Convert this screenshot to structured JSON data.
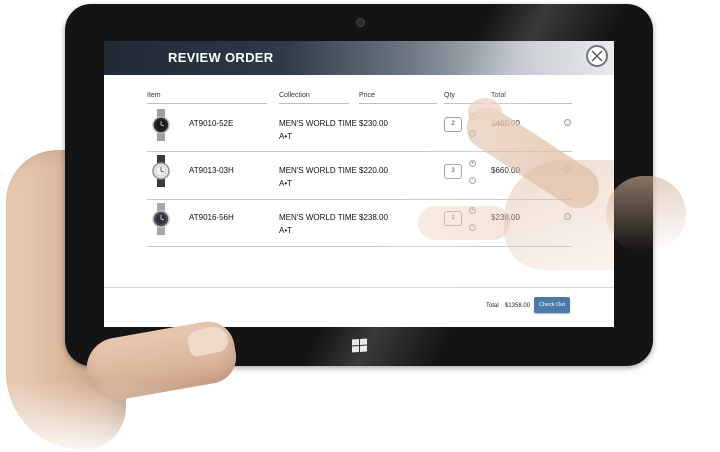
{
  "header": {
    "title": "REVIEW ORDER"
  },
  "columns": {
    "item": "Item",
    "collection": "Collection",
    "price": "Price",
    "qty": "Qty",
    "total": "Total"
  },
  "rows": [
    {
      "sku": "AT9010-52E",
      "collection_line1": "MEN'S WORLD TIME",
      "collection_line2": "A•T",
      "price": "$230.00",
      "qty": "2",
      "total": "$460.00"
    },
    {
      "sku": "AT9013-03H",
      "collection_line1": "MEN'S WORLD TIME",
      "collection_line2": "A•T",
      "price": "$220.00",
      "qty": "3",
      "total": "$660.00"
    },
    {
      "sku": "AT9016-56H",
      "collection_line1": "MEN'S WORLD TIME",
      "collection_line2": "A•T",
      "price": "$238.00",
      "qty": "1",
      "total": "$238.00"
    }
  ],
  "footer": {
    "total_label": "Total",
    "total_value": "$1358.00",
    "checkout_label": "Check Out"
  },
  "icons": {
    "close": "close-icon",
    "increment": "plus-icon",
    "decrement": "minus-icon",
    "remove": "remove-icon",
    "windows": "windows-logo-icon"
  },
  "colors": {
    "header_dark": "#1f2a35",
    "checkout_button": "#4c79aa",
    "bezel": "#141414"
  }
}
